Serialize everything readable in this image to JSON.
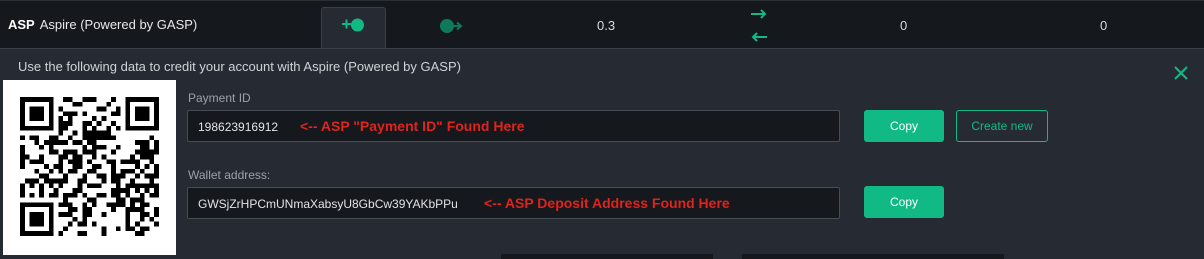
{
  "coin_row": {
    "ticker": "ASP",
    "name": "Aspire (Powered by GASP)",
    "balances": [
      "0.3",
      "0",
      "0"
    ]
  },
  "icons": {
    "deposit": "deposit-plus-icon",
    "withdraw": "withdraw-arrow-icon",
    "transfer": "transfer-arrows-icon",
    "close": "close-icon",
    "qr": "qr-code-icon"
  },
  "deposit_panel": {
    "heading": "Use the following data to credit your account with Aspire (Powered by GASP)",
    "payment_id": {
      "label": "Payment ID",
      "value": "198623916912",
      "annotation": "<-- ASP \"Payment ID\" Found Here",
      "copy_label": "Copy",
      "create_label": "Create new"
    },
    "wallet": {
      "label": "Wallet address:",
      "value": "GWSjZrHPCmUNmaXabsyU8GbCw39YAKbPPu",
      "annotation": "<-- ASP Deposit Address Found Here",
      "copy_label": "Copy"
    }
  },
  "colors": {
    "accent": "#11b985",
    "annotation": "#e0231c",
    "panel_bg": "#262b33",
    "page_bg": "#15181d"
  }
}
